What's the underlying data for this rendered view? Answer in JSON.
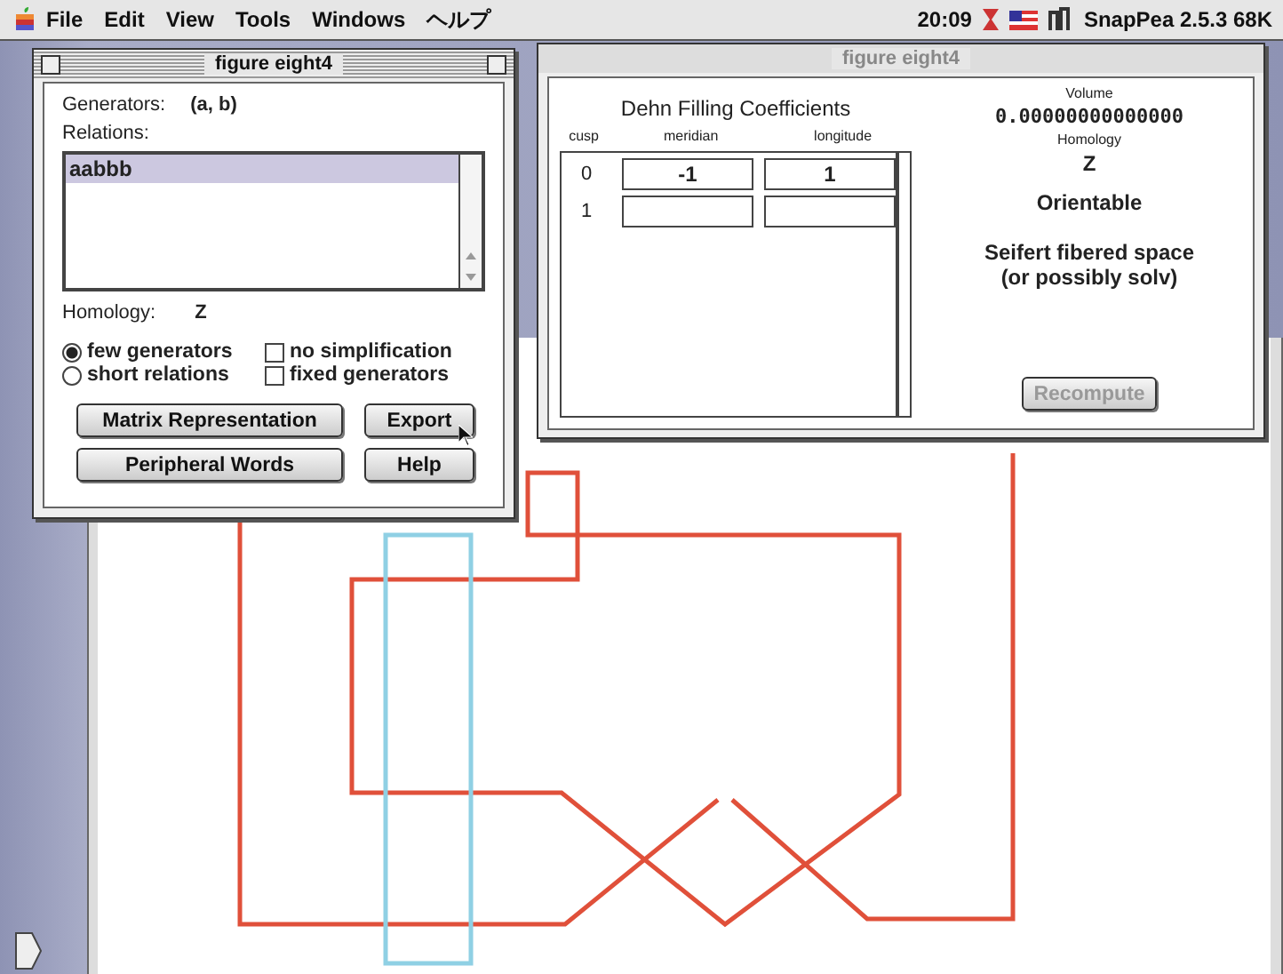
{
  "menu_bar": {
    "menus": [
      "File",
      "Edit",
      "View",
      "Tools",
      "Windows",
      "ヘルプ"
    ],
    "clock": "20:09",
    "application": "SnapPea 2.5.3 68K"
  },
  "presentation_window": {
    "title": "figure eight4",
    "generators_label": "Generators:",
    "generators": "(a, b)",
    "relations_label": "Relations:",
    "relations": [
      {
        "text": "aabbb",
        "selected": true
      }
    ],
    "homology_label": "Homology:",
    "homology": "Z",
    "radios": [
      {
        "label": "few generators",
        "selected": true
      },
      {
        "label": "short relations",
        "selected": false
      }
    ],
    "checkboxes": [
      {
        "label": "no simplification",
        "checked": false
      },
      {
        "label": "fixed generators",
        "checked": false
      }
    ],
    "buttons": [
      "Matrix Representation",
      "Export",
      "Peripheral Words",
      "Help"
    ]
  },
  "dehn_window": {
    "title": "figure eight4",
    "heading": "Dehn Filling Coefficients",
    "columns": [
      "cusp",
      "meridian",
      "longitude"
    ],
    "rows": [
      {
        "cusp": "0",
        "meridian": "-1",
        "longitude": "1"
      },
      {
        "cusp": "1"
      }
    ],
    "volume_label": "Volume",
    "volume": "0.00000000000000",
    "homology_label": "Homology",
    "homology": "Z",
    "orientability": "Orientable",
    "geometry": [
      "Seifert fibered space",
      "(or possibly solv)"
    ],
    "recompute": {
      "label": "Recompute",
      "disabled": true
    }
  }
}
